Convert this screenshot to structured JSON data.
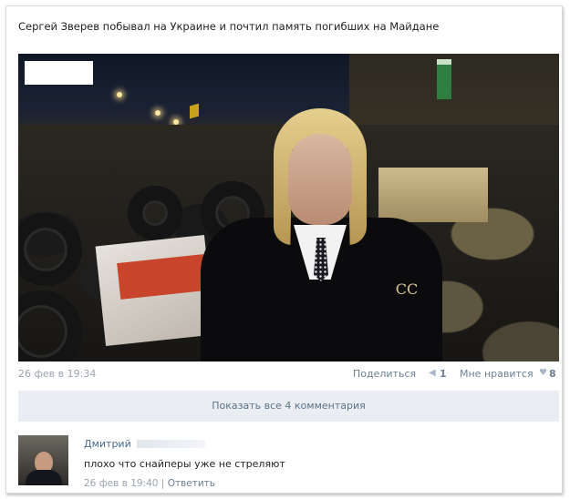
{
  "post": {
    "text": "Сергей Зверев побывал на Украине и почтил память погибших на Майдане",
    "brooch_text": "CC"
  },
  "meta": {
    "date": "26 фев в 19:34",
    "share_label": "Поделиться",
    "share_count": "1",
    "like_label": "Мне нравится",
    "like_count": "8",
    "share_icon": "megaphone-icon",
    "like_icon": "heart-icon"
  },
  "comments": {
    "show_all_label": "Показать все 4 комментария"
  },
  "comment": {
    "author": "Дмитрий",
    "text": "плохо что снайперы уже не стреляют",
    "date": "26 фев в 19:40",
    "separator": "|",
    "reply_label": "Ответить"
  },
  "colors": {
    "link": "#6d7f93",
    "meta": "#9aa3ad",
    "bar": "#eaeef3"
  }
}
